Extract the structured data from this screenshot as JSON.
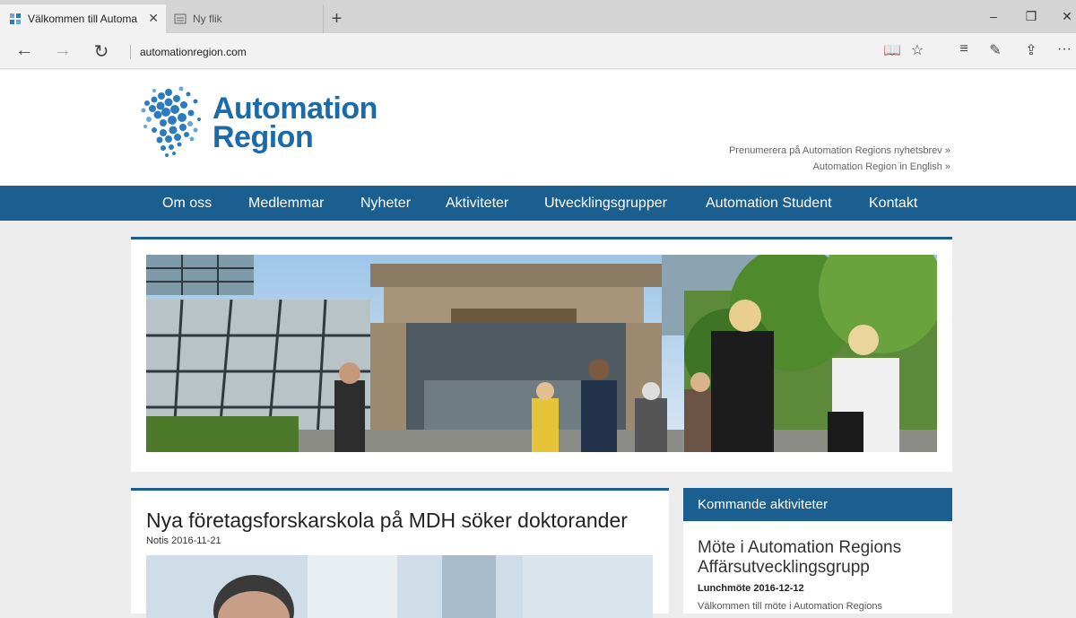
{
  "browser": {
    "tabs": [
      {
        "title": "Välkommen till Automa",
        "active": true
      },
      {
        "title": "Ny flik",
        "active": false
      }
    ],
    "url": "automationregion.com",
    "window_controls": {
      "minimize": "–",
      "restore": "❐",
      "close": "✕"
    },
    "nav": {
      "back": "←",
      "forward": "→",
      "refresh": "↻"
    },
    "tools": {
      "reading_view": "📖",
      "favorite": "☆",
      "hub": "≡",
      "notes": "✎",
      "share": "⇪",
      "more": "···"
    }
  },
  "site": {
    "logo_line1": "Automation",
    "logo_line2": "Region",
    "header_links": [
      "Prenumerera på Automation Regions nyhetsbrev »",
      "Automation Region in English »"
    ],
    "nav": [
      "Om oss",
      "Medlemmar",
      "Nyheter",
      "Aktiviteter",
      "Utvecklingsgrupper",
      "Automation Student",
      "Kontakt"
    ],
    "news": {
      "title": "Nya företagsforskarskola på MDH söker doktorander",
      "meta": "Notis 2016-11-21"
    },
    "upcoming": {
      "heading": "Kommande aktiviteter",
      "title": "Möte i Automation Regions Affärsutvecklingsgrupp",
      "meta": "Lunchmöte 2016-12-12",
      "text": "Välkommen till möte i Automation Regions"
    }
  },
  "colors": {
    "brand": "#1a5f90",
    "logo": "#1b6aa9"
  }
}
